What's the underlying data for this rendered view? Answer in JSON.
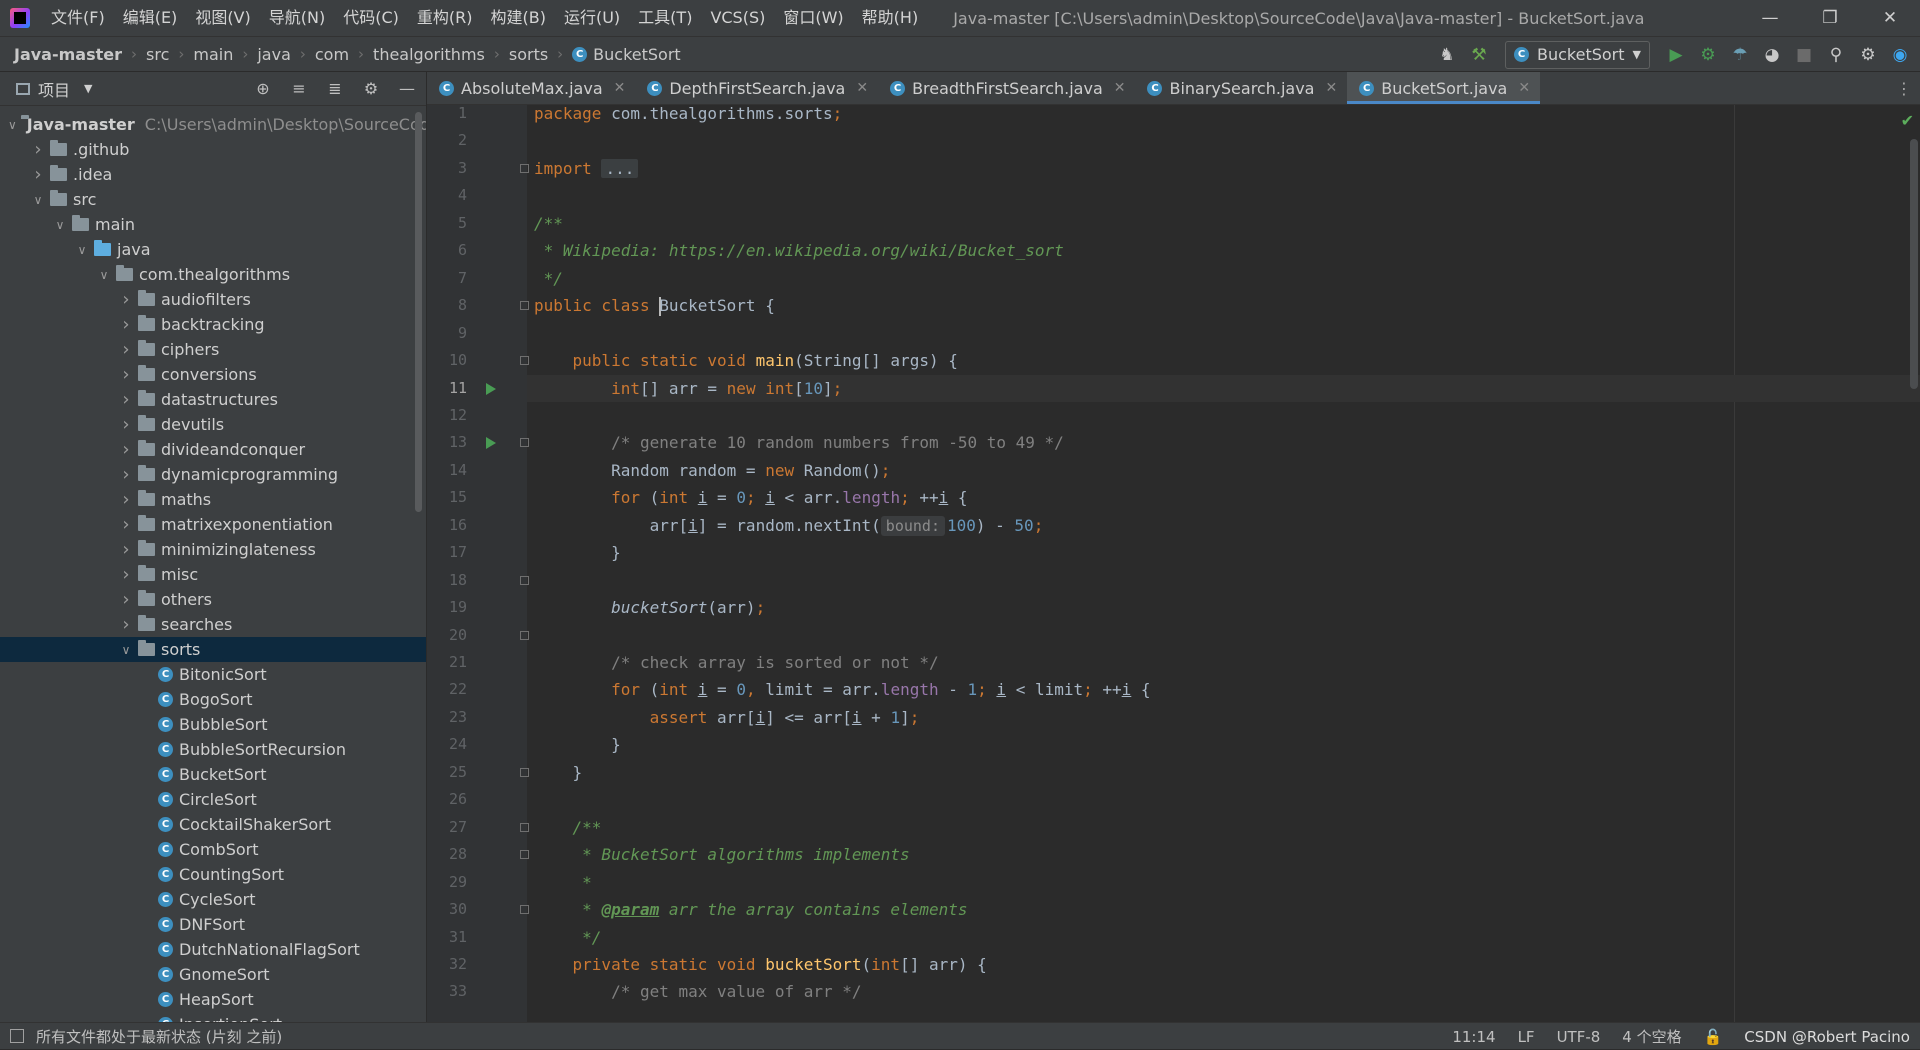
{
  "menu": [
    "文件(F)",
    "编辑(E)",
    "视图(V)",
    "导航(N)",
    "代码(C)",
    "重构(R)",
    "构建(B)",
    "运行(U)",
    "工具(T)",
    "VCS(S)",
    "窗口(W)",
    "帮助(H)"
  ],
  "window_title": "Java-master [C:\\Users\\admin\\Desktop\\SourceCode\\Java\\Java-master] - BucketSort.java",
  "breadcrumbs": [
    "Java-master",
    "src",
    "main",
    "java",
    "com",
    "thealgorithms",
    "sorts",
    "BucketSort"
  ],
  "run_config": "BucketSort",
  "project_panel": {
    "title": "项目",
    "tree": [
      {
        "label": "Java-master",
        "hint": "C:\\Users\\admin\\Desktop\\SourceCode",
        "depth": 0,
        "kind": "module",
        "state": "open"
      },
      {
        "label": ".github",
        "depth": 1,
        "kind": "folder",
        "state": "closed"
      },
      {
        "label": ".idea",
        "depth": 1,
        "kind": "folder",
        "state": "closed"
      },
      {
        "label": "src",
        "depth": 1,
        "kind": "folder",
        "state": "open"
      },
      {
        "label": "main",
        "depth": 2,
        "kind": "folder",
        "state": "open"
      },
      {
        "label": "java",
        "depth": 3,
        "kind": "srcfolder",
        "state": "open"
      },
      {
        "label": "com.thealgorithms",
        "depth": 4,
        "kind": "folder",
        "state": "open"
      },
      {
        "label": "audiofilters",
        "depth": 5,
        "kind": "folder",
        "state": "closed"
      },
      {
        "label": "backtracking",
        "depth": 5,
        "kind": "folder",
        "state": "closed"
      },
      {
        "label": "ciphers",
        "depth": 5,
        "kind": "folder",
        "state": "closed"
      },
      {
        "label": "conversions",
        "depth": 5,
        "kind": "folder",
        "state": "closed"
      },
      {
        "label": "datastructures",
        "depth": 5,
        "kind": "folder",
        "state": "closed"
      },
      {
        "label": "devutils",
        "depth": 5,
        "kind": "folder",
        "state": "closed"
      },
      {
        "label": "divideandconquer",
        "depth": 5,
        "kind": "folder",
        "state": "closed"
      },
      {
        "label": "dynamicprogramming",
        "depth": 5,
        "kind": "folder",
        "state": "closed"
      },
      {
        "label": "maths",
        "depth": 5,
        "kind": "folder",
        "state": "closed"
      },
      {
        "label": "matrixexponentiation",
        "depth": 5,
        "kind": "folder",
        "state": "closed"
      },
      {
        "label": "minimizinglateness",
        "depth": 5,
        "kind": "folder",
        "state": "closed"
      },
      {
        "label": "misc",
        "depth": 5,
        "kind": "folder",
        "state": "closed"
      },
      {
        "label": "others",
        "depth": 5,
        "kind": "folder",
        "state": "closed"
      },
      {
        "label": "searches",
        "depth": 5,
        "kind": "folder",
        "state": "closed"
      },
      {
        "label": "sorts",
        "depth": 5,
        "kind": "folder",
        "state": "open",
        "selected": true
      },
      {
        "label": "BitonicSort",
        "depth": 6,
        "kind": "class"
      },
      {
        "label": "BogoSort",
        "depth": 6,
        "kind": "class"
      },
      {
        "label": "BubbleSort",
        "depth": 6,
        "kind": "class"
      },
      {
        "label": "BubbleSortRecursion",
        "depth": 6,
        "kind": "class"
      },
      {
        "label": "BucketSort",
        "depth": 6,
        "kind": "class"
      },
      {
        "label": "CircleSort",
        "depth": 6,
        "kind": "class"
      },
      {
        "label": "CocktailShakerSort",
        "depth": 6,
        "kind": "class"
      },
      {
        "label": "CombSort",
        "depth": 6,
        "kind": "class"
      },
      {
        "label": "CountingSort",
        "depth": 6,
        "kind": "class"
      },
      {
        "label": "CycleSort",
        "depth": 6,
        "kind": "class"
      },
      {
        "label": "DNFSort",
        "depth": 6,
        "kind": "class"
      },
      {
        "label": "DutchNationalFlagSort",
        "depth": 6,
        "kind": "class"
      },
      {
        "label": "GnomeSort",
        "depth": 6,
        "kind": "class"
      },
      {
        "label": "HeapSort",
        "depth": 6,
        "kind": "class"
      },
      {
        "label": "InsertionSort",
        "depth": 6,
        "kind": "class"
      }
    ]
  },
  "tabs": [
    {
      "label": "AbsoluteMax.java",
      "active": false
    },
    {
      "label": "DepthFirstSearch.java",
      "active": false
    },
    {
      "label": "BreadthFirstSearch.java",
      "active": false
    },
    {
      "label": "BinarySearch.java",
      "active": false
    },
    {
      "label": "BucketSort.java",
      "active": true
    }
  ],
  "editor": {
    "current_line": 11,
    "run_markers": [
      11,
      13
    ],
    "fold_markers": [
      3,
      8,
      10,
      13,
      18,
      20,
      25,
      27,
      28,
      30,
      34,
      35
    ],
    "lines": [
      [
        [
          "kw",
          "package "
        ],
        [
          "",
          "com.thealgorithms.sorts"
        ],
        [
          "kw",
          ";"
        ]
      ],
      [],
      [
        [
          "kw",
          "import "
        ],
        [
          "pill",
          "..."
        ]
      ],
      [],
      [
        [
          "doc",
          "/**"
        ]
      ],
      [
        [
          "doc",
          " * Wikipedia: https://en.wikipedia.org/wiki/Bucket_sort"
        ]
      ],
      [
        [
          "doc",
          " */"
        ]
      ],
      [
        [
          "kw",
          "public class "
        ],
        [
          "caret",
          ""
        ],
        [
          "",
          "BucketSort {"
        ]
      ],
      [],
      [
        [
          "",
          "    "
        ],
        [
          "kw",
          "public static void "
        ],
        [
          "fn",
          "main"
        ],
        [
          "",
          "(String[] args) {"
        ]
      ],
      [
        [
          "",
          "        "
        ],
        [
          "kw",
          "int"
        ],
        [
          "",
          "[] arr = "
        ],
        [
          "kw",
          "new int"
        ],
        [
          "",
          "["
        ],
        [
          "num",
          "10"
        ],
        [
          "",
          "]"
        ],
        [
          "kw",
          ";"
        ]
      ],
      [],
      [
        [
          "",
          "        "
        ],
        [
          "cmt",
          "/* generate 10 random numbers from -50 to 49 */"
        ]
      ],
      [
        [
          "",
          "        Random random = "
        ],
        [
          "kw",
          "new "
        ],
        [
          "",
          "Random()"
        ],
        [
          "kw",
          ";"
        ]
      ],
      [
        [
          "",
          "        "
        ],
        [
          "kw",
          "for "
        ],
        [
          "",
          "("
        ],
        [
          "kw",
          "int "
        ],
        [
          "uvar",
          "i"
        ],
        [
          "",
          " = "
        ],
        [
          "num",
          "0"
        ],
        [
          "kw",
          "; "
        ],
        [
          "uvar",
          "i"
        ],
        [
          "",
          " < arr."
        ],
        [
          "fld",
          "length"
        ],
        [
          "kw",
          "; "
        ],
        [
          "",
          "++"
        ],
        [
          "uvar",
          "i"
        ],
        [
          "",
          " {"
        ]
      ],
      [
        [
          "",
          "            arr["
        ],
        [
          "uvar",
          "i"
        ],
        [
          "",
          "] = random.nextInt("
        ],
        [
          "hint",
          "bound:"
        ],
        [
          "num",
          "100"
        ],
        [
          "",
          ") - "
        ],
        [
          "num",
          "50"
        ],
        [
          "kw",
          ";"
        ]
      ],
      [
        [
          "",
          "        }"
        ]
      ],
      [],
      [
        [
          "",
          "        "
        ],
        [
          "itl",
          "bucketSort"
        ],
        [
          "",
          "(arr)"
        ],
        [
          "kw",
          ";"
        ]
      ],
      [],
      [
        [
          "",
          "        "
        ],
        [
          "cmt",
          "/* check array is sorted or not */"
        ]
      ],
      [
        [
          "",
          "        "
        ],
        [
          "kw",
          "for "
        ],
        [
          "",
          "("
        ],
        [
          "kw",
          "int "
        ],
        [
          "uvar",
          "i"
        ],
        [
          "",
          " = "
        ],
        [
          "num",
          "0"
        ],
        [
          "kw",
          ", "
        ],
        [
          "",
          "limit = arr."
        ],
        [
          "fld",
          "length"
        ],
        [
          "",
          " - "
        ],
        [
          "num",
          "1"
        ],
        [
          "kw",
          "; "
        ],
        [
          "uvar",
          "i"
        ],
        [
          "",
          " < limit"
        ],
        [
          "kw",
          "; "
        ],
        [
          "",
          "++"
        ],
        [
          "uvar",
          "i"
        ],
        [
          "",
          " {"
        ]
      ],
      [
        [
          "",
          "            "
        ],
        [
          "kw",
          "assert "
        ],
        [
          "",
          "arr["
        ],
        [
          "uvar",
          "i"
        ],
        [
          "",
          "] <= arr["
        ],
        [
          "uvar",
          "i"
        ],
        [
          "",
          " + "
        ],
        [
          "num",
          "1"
        ],
        [
          "",
          "]"
        ],
        [
          "kw",
          ";"
        ]
      ],
      [
        [
          "",
          "        }"
        ]
      ],
      [
        [
          "",
          "    }"
        ]
      ],
      [],
      [
        [
          "",
          "    "
        ],
        [
          "doc",
          "/**"
        ]
      ],
      [
        [
          "",
          "    "
        ],
        [
          "doc",
          " * BucketSort algorithms implements"
        ]
      ],
      [
        [
          "",
          "    "
        ],
        [
          "doc",
          " *"
        ]
      ],
      [
        [
          "",
          "    "
        ],
        [
          "doc",
          " * "
        ],
        [
          "doctag",
          "@param"
        ],
        [
          "doc",
          " arr the array contains elements"
        ]
      ],
      [
        [
          "",
          "    "
        ],
        [
          "doc",
          " */"
        ]
      ],
      [
        [
          "",
          "    "
        ],
        [
          "kw",
          "private static void "
        ],
        [
          "fn",
          "bucketSort"
        ],
        [
          "",
          "("
        ],
        [
          "kw",
          "int"
        ],
        [
          "",
          "[] arr) {"
        ]
      ],
      [
        [
          "",
          "        "
        ],
        [
          "cmt",
          "/* get max value of arr */"
        ]
      ]
    ]
  },
  "status": {
    "message": "所有文件都处于最新状态 (片刻 之前)",
    "position": "11:14",
    "line_sep": "LF",
    "encoding": "UTF-8",
    "indent": "4 个空格",
    "watermark": "CSDN @Robert Pacino"
  },
  "colors": {
    "accent": "#4a88c7",
    "run": "#499c54",
    "class_icon": "#3d8fbf"
  }
}
